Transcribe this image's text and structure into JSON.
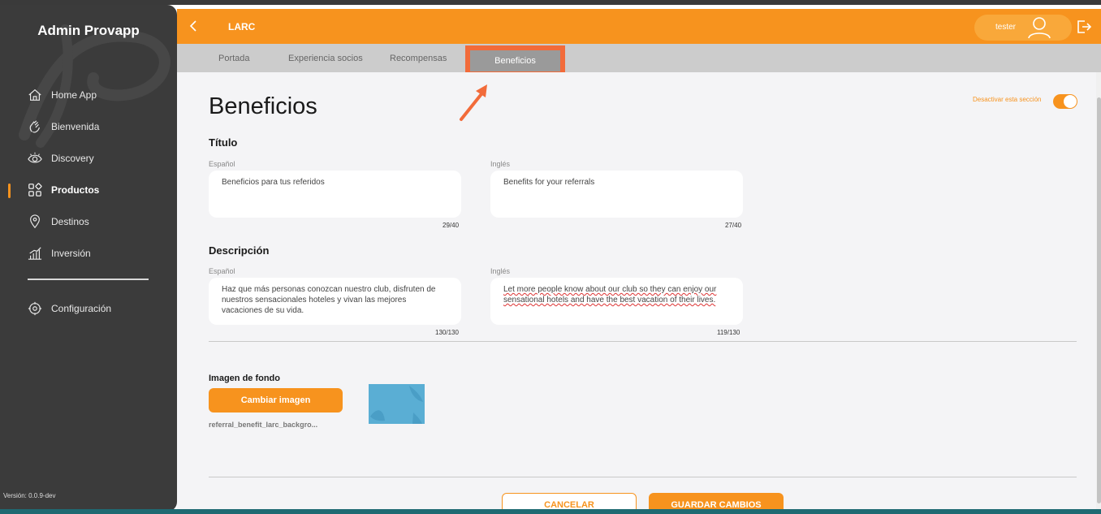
{
  "app": {
    "title": "Admin Provapp",
    "version": "Versión: 0.0.9-dev"
  },
  "sidebar": {
    "items": [
      {
        "label": "Home App",
        "icon": "home-icon"
      },
      {
        "label": "Bienvenida",
        "icon": "wave-hand-icon"
      },
      {
        "label": "Discovery",
        "icon": "eye-icon"
      },
      {
        "label": "Productos",
        "icon": "grid-icon",
        "active": true
      },
      {
        "label": "Destinos",
        "icon": "location-pin-icon"
      },
      {
        "label": "Inversión",
        "icon": "bar-chart-icon"
      },
      {
        "label": "Configuración",
        "icon": "gear-icon"
      }
    ]
  },
  "header": {
    "title": "LARC",
    "user": "tester"
  },
  "tabs": [
    {
      "label": "Portada"
    },
    {
      "label": "Experiencia socios"
    },
    {
      "label": "Recompensas"
    },
    {
      "label": "Beneficios",
      "active": true
    }
  ],
  "main": {
    "page_title": "Beneficios",
    "toggle_label": "Desactivar esta sección",
    "toggle_on": true,
    "titulo": {
      "heading": "Título",
      "es_label": "Español",
      "es_value": "Beneficios para tus referidos",
      "es_count": "29/40",
      "en_label": "Inglés",
      "en_value": "Benefits for your referrals",
      "en_count": "27/40"
    },
    "descripcion": {
      "heading": "Descripción",
      "es_label": "Español",
      "es_value": "Haz que más personas conozcan nuestro club, disfruten de nuestros sensacionales hoteles y vivan las mejores vacaciones de su vida.",
      "es_count": "130/130",
      "en_label": "Inglés",
      "en_value": "Let more people know about our club so they can enjoy our sensational hotels and have the best vacation of their lives.",
      "en_count": "119/130"
    },
    "image": {
      "label": "Imagen de fondo",
      "button": "Cambiar imagen",
      "filename": "referral_benefit_larc_backgro..."
    },
    "actions": {
      "cancel": "CANCELAR",
      "save": "GUARDAR CAMBIOS"
    }
  },
  "colors": {
    "accent": "#f7931e",
    "sidebar": "#3b3b3b",
    "highlight": "#f26b3a"
  }
}
